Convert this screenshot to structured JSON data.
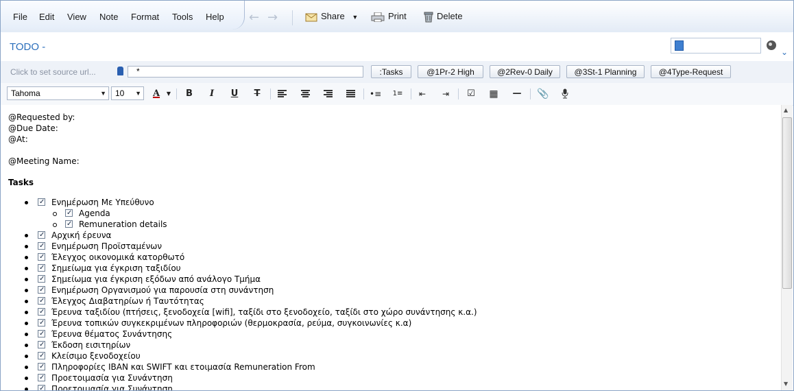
{
  "menu": [
    "File",
    "Edit",
    "View",
    "Note",
    "Format",
    "Tools",
    "Help"
  ],
  "toolbar": {
    "share": "Share",
    "print": "Print",
    "delete": "Delete"
  },
  "note": {
    "title": "TODO -"
  },
  "source": {
    "placeholder": "Click to set source url...",
    "filter_value": " *"
  },
  "tag_buttons": [
    ":Tasks",
    "@1Pr-2 High",
    "@2Rev-0 Daily",
    "@3St-1 Planning",
    "@4Type-Request"
  ],
  "format": {
    "font": "Tahoma",
    "size": "10"
  },
  "meta_lines": [
    "@Requested by:",
    "@Due Date:",
    "@At:",
    "",
    "@Meeting Name:"
  ],
  "tasks_heading": "Tasks",
  "tasks": [
    {
      "text": "Ενημέρωση Με Υπεύθυνο",
      "level": 0,
      "checked": true
    },
    {
      "text": " Agenda",
      "level": 1,
      "checked": true
    },
    {
      "text": "Remuneration details",
      "level": 1,
      "checked": true
    },
    {
      "text": "Αρχική έρευνα",
      "level": 0,
      "checked": true
    },
    {
      "text": "Ενημέρωση Προϊσταμένων",
      "level": 0,
      "checked": true
    },
    {
      "text": "Έλεγχος οικονομικά κατορθωτό",
      "level": 0,
      "checked": true
    },
    {
      "text": "Σημείωμα για έγκριση ταξιδίου",
      "level": 0,
      "checked": true
    },
    {
      "text": "Σημείωμα για έγκριση εξόδων από ανάλογο Τμήμα",
      "level": 0,
      "checked": true
    },
    {
      "text": "Ενημέρωση Οργανισμού για παρουσία στη συνάντηση",
      "level": 0,
      "checked": true
    },
    {
      "text": "Έλεγχος Διαβατηρίων ή Ταυτότητας",
      "level": 0,
      "checked": true
    },
    {
      "text": "Έρευνα ταξιδίου (πτήσεις, ξενοδοχεία [wifi], ταξίδι στο ξενοδοχείο, ταξίδι στο χώρο συνάντησης  κ.α.)",
      "level": 0,
      "checked": true
    },
    {
      "text": "Έρευνα τοπικών συγκεκριμένων πληροφοριών (θερμοκρασία, ρεύμα, συγκοινωνίες κ.α)",
      "level": 0,
      "checked": true
    },
    {
      "text": "Έρευνα θέματος Συνάντησης",
      "level": 0,
      "checked": true
    },
    {
      "text": "Έκδοση εισιτηρίων",
      "level": 0,
      "checked": true
    },
    {
      "text": "Κλείσιμο ξενοδοχείου",
      "level": 0,
      "checked": true
    },
    {
      "text": "Πληροφορίες IBAN και SWIFT και ετοιμασία Remuneration From",
      "level": 0,
      "checked": true
    },
    {
      "text": "Προετοιμασία για Συνάντηση",
      "level": 0,
      "checked": true
    },
    {
      "text": "Προετοιμασία για Συνάντηση",
      "level": 0,
      "checked": true
    }
  ]
}
